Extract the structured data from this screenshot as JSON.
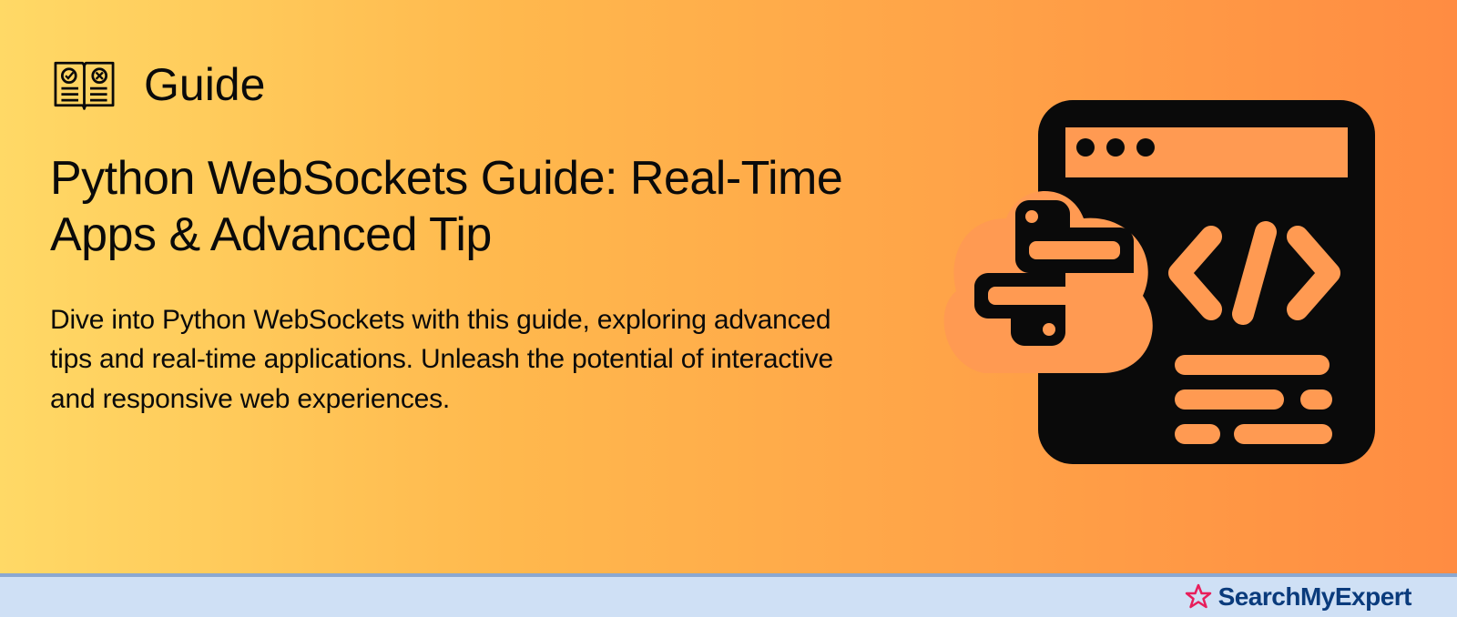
{
  "header": {
    "label": "Guide"
  },
  "title": "Python WebSockets Guide: Real-Time Apps & Advanced Tip",
  "description": "Dive into Python WebSockets with this guide, exploring advanced tips and real-time applications. Unleash the potential of interactive and responsive web experiences.",
  "brand": {
    "name": "SearchMyExpert"
  }
}
